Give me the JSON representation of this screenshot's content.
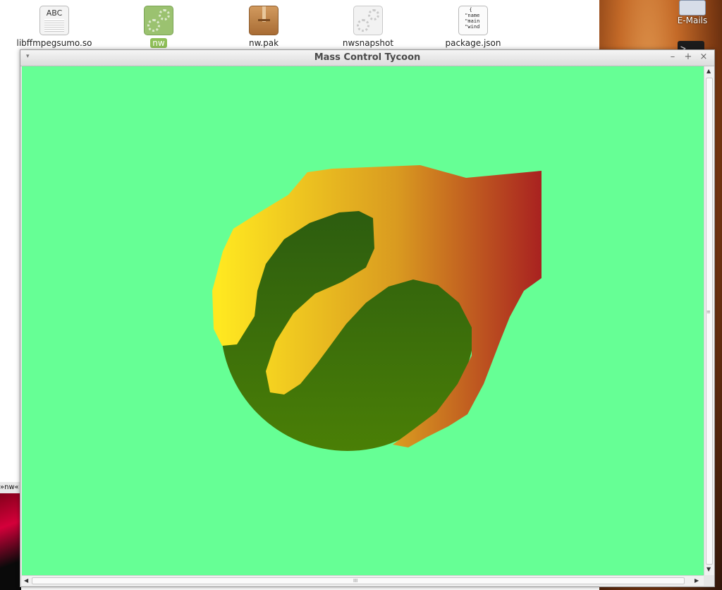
{
  "desktop": {
    "files": [
      {
        "label": "libffmpegsumo.so",
        "icon": "text-document-icon",
        "icon_text": "ABC"
      },
      {
        "label": "nw",
        "icon": "executable-gear-icon",
        "selected": true
      },
      {
        "label": "nw.pak",
        "icon": "package-icon"
      },
      {
        "label": "nwsnapshot",
        "icon": "executable-gear-icon"
      },
      {
        "label": "package.json",
        "icon": "json-document-icon",
        "icon_text": "{\n \"name\n \"main\n \"wind"
      }
    ],
    "mail_label": "E-Mails",
    "terminal_glyph": ">_",
    "taskbar_fragment": "»nw«"
  },
  "window": {
    "title": "Mass Control Tycoon",
    "menu_glyph": "▾",
    "minimize_glyph": "–",
    "maximize_glyph": "+",
    "close_glyph": "×"
  },
  "canvas": {
    "background": "#66ff95",
    "flame_colors": [
      "#ffe820",
      "#d99a20",
      "#a82020"
    ],
    "planet_colors": [
      "#2a5a10",
      "#4a7f06"
    ]
  },
  "scrollbars": {
    "up": "▲",
    "down": "▼",
    "left": "◀",
    "right": "▶",
    "grip_v": "≡",
    "grip_h": "III"
  }
}
